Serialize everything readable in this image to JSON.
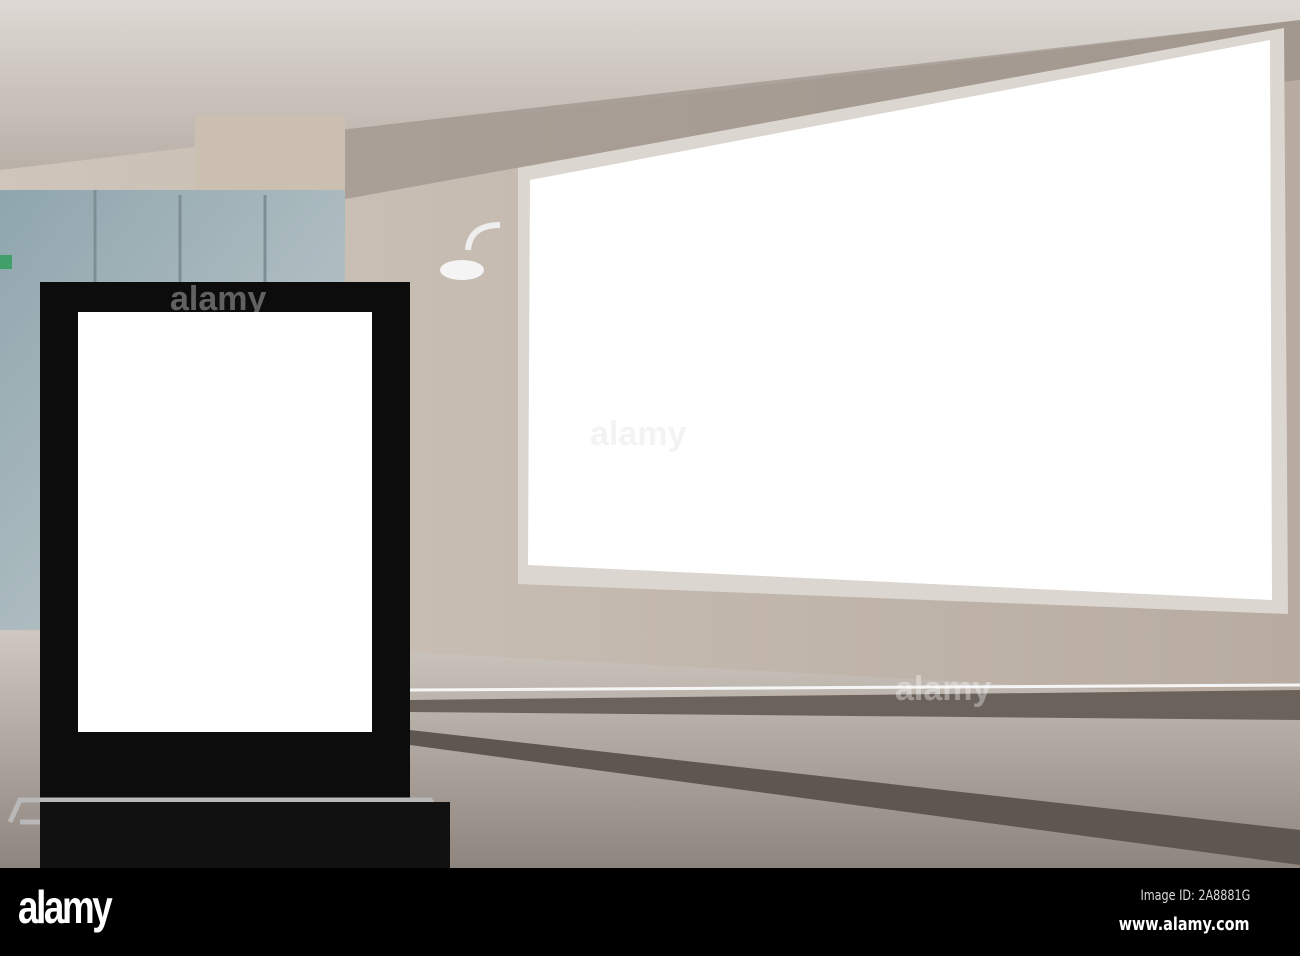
{
  "photo": {
    "subject": "Blank advertising billboards in airport walkway",
    "watermark_text": "alamy"
  },
  "footer": {
    "logo": "alamy",
    "image_id": "Image ID: 2A8881G",
    "url": "www.alamy.com"
  },
  "colors": {
    "wall": "#c9bfb6",
    "ceiling": "#d8d2cc",
    "stand": "#0c0c0c",
    "screen": "#ffffff"
  }
}
